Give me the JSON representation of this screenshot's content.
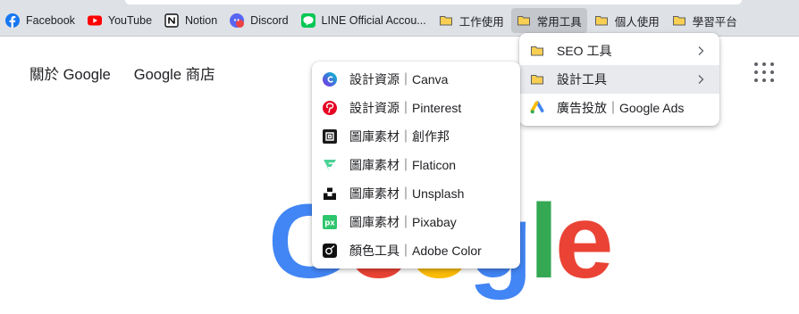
{
  "bookmarks_bar": {
    "items": [
      {
        "label": "Facebook",
        "icon": "facebook-icon"
      },
      {
        "label": "YouTube",
        "icon": "youtube-icon"
      },
      {
        "label": "Notion",
        "icon": "notion-icon"
      },
      {
        "label": "Discord",
        "icon": "discord-icon"
      },
      {
        "label": "LINE Official Accou...",
        "icon": "line-icon"
      },
      {
        "label": "工作使用",
        "icon": "folder-icon"
      },
      {
        "label": "常用工具",
        "icon": "folder-icon"
      },
      {
        "label": "個人使用",
        "icon": "folder-icon"
      },
      {
        "label": "學習平台",
        "icon": "folder-icon"
      }
    ]
  },
  "google_header": {
    "about": "關於 Google",
    "store": "Google 商店"
  },
  "logo": {
    "letters": [
      "G",
      "o",
      "o",
      "g",
      "l",
      "e"
    ]
  },
  "tools_menu": {
    "items": [
      {
        "label": "SEO 工具",
        "icon": "folder-icon",
        "has_submenu": true
      },
      {
        "label": "設計工具",
        "icon": "folder-icon",
        "has_submenu": true,
        "highlighted": true
      },
      {
        "label": "廣告投放｜Google Ads",
        "icon": "google-ads-icon",
        "has_submenu": false
      }
    ]
  },
  "design_menu": {
    "items": [
      {
        "label": "設計資源｜Canva",
        "icon": "canva-icon"
      },
      {
        "label": "設計資源｜Pinterest",
        "icon": "pinterest-icon"
      },
      {
        "label": "圖庫素材｜創作邦",
        "icon": "chuangzuobang-icon"
      },
      {
        "label": "圖庫素材｜Flaticon",
        "icon": "flaticon-icon"
      },
      {
        "label": "圖庫素材｜Unsplash",
        "icon": "unsplash-icon"
      },
      {
        "label": "圖庫素材｜Pixabay",
        "icon": "pixabay-icon"
      },
      {
        "label": "顏色工具｜Adobe Color",
        "icon": "adobe-color-icon"
      }
    ]
  },
  "colors": {
    "bookmarks_bg": "#dee1e6",
    "menu_highlight": "#e8eaed",
    "folder": "#f9cf53"
  }
}
